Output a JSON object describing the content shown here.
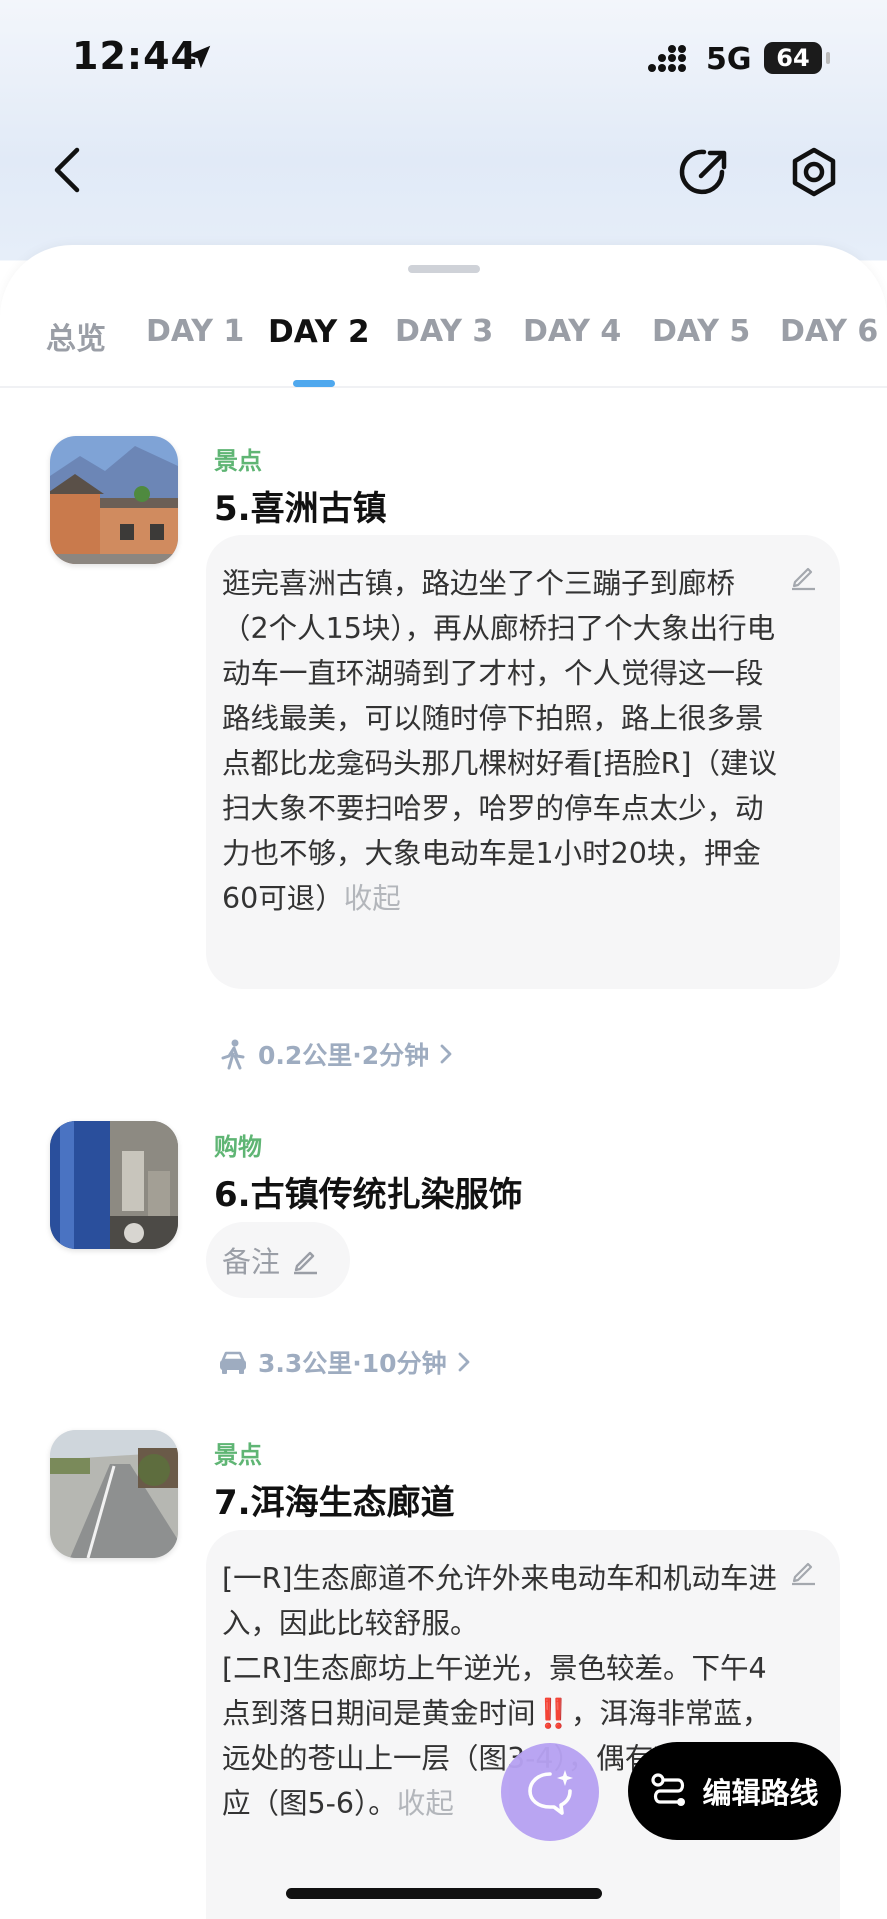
{
  "status_bar": {
    "time": "12:44",
    "network": "5G",
    "battery": "64"
  },
  "tabs": [
    "总览",
    "DAY 1",
    "DAY 2",
    "DAY 3",
    "DAY 4",
    "DAY 5",
    "DAY 6"
  ],
  "active_tab": "DAY 2",
  "pois": [
    {
      "category": "景点",
      "title": "5.喜洲古镇",
      "note": "逛完喜洲古镇，路边坐了个三蹦子到廊桥（2个人15块），再从廊桥扫了个大象出行电动车一直环湖骑到了才村，个人觉得这一段路线最美，可以随时停下拍照，路上很多景点都比龙龛码头那几棵树好看[捂脸R]（建议扫大象不要扫哈罗，哈罗的停车点太少，动力也不够，大象电动车是1小时20块，押金60可退）",
      "collapse_label": "收起"
    },
    {
      "category": "购物",
      "title": "6.古镇传统扎染服饰",
      "remark_label": "备注"
    },
    {
      "category": "景点",
      "title": "7.洱海生态廊道",
      "note_lines": [
        "[一R]生态廊道不允许外来电动车和机动车进入，因此比较舒服。",
        "[二R]生态廊坊上午逆光，景色较差。下午4点到落日期间是黄金时间‼️，洱海非常蓝，远处的苍山上一层（图3-4），偶有丁达尔效应（图5-6）。"
      ],
      "collapse_label": "收起"
    }
  ],
  "travel": [
    {
      "mode": "walk-icon",
      "text": "0.2公里·2分钟"
    },
    {
      "mode": "car-icon",
      "text": "3.3公里·10分钟"
    }
  ],
  "fab": {
    "edit_route_label": "编辑路线"
  },
  "colors": {
    "accent": "#4fa8ee",
    "category": "#5fb574",
    "ai_fab": "#b7a2f2"
  }
}
